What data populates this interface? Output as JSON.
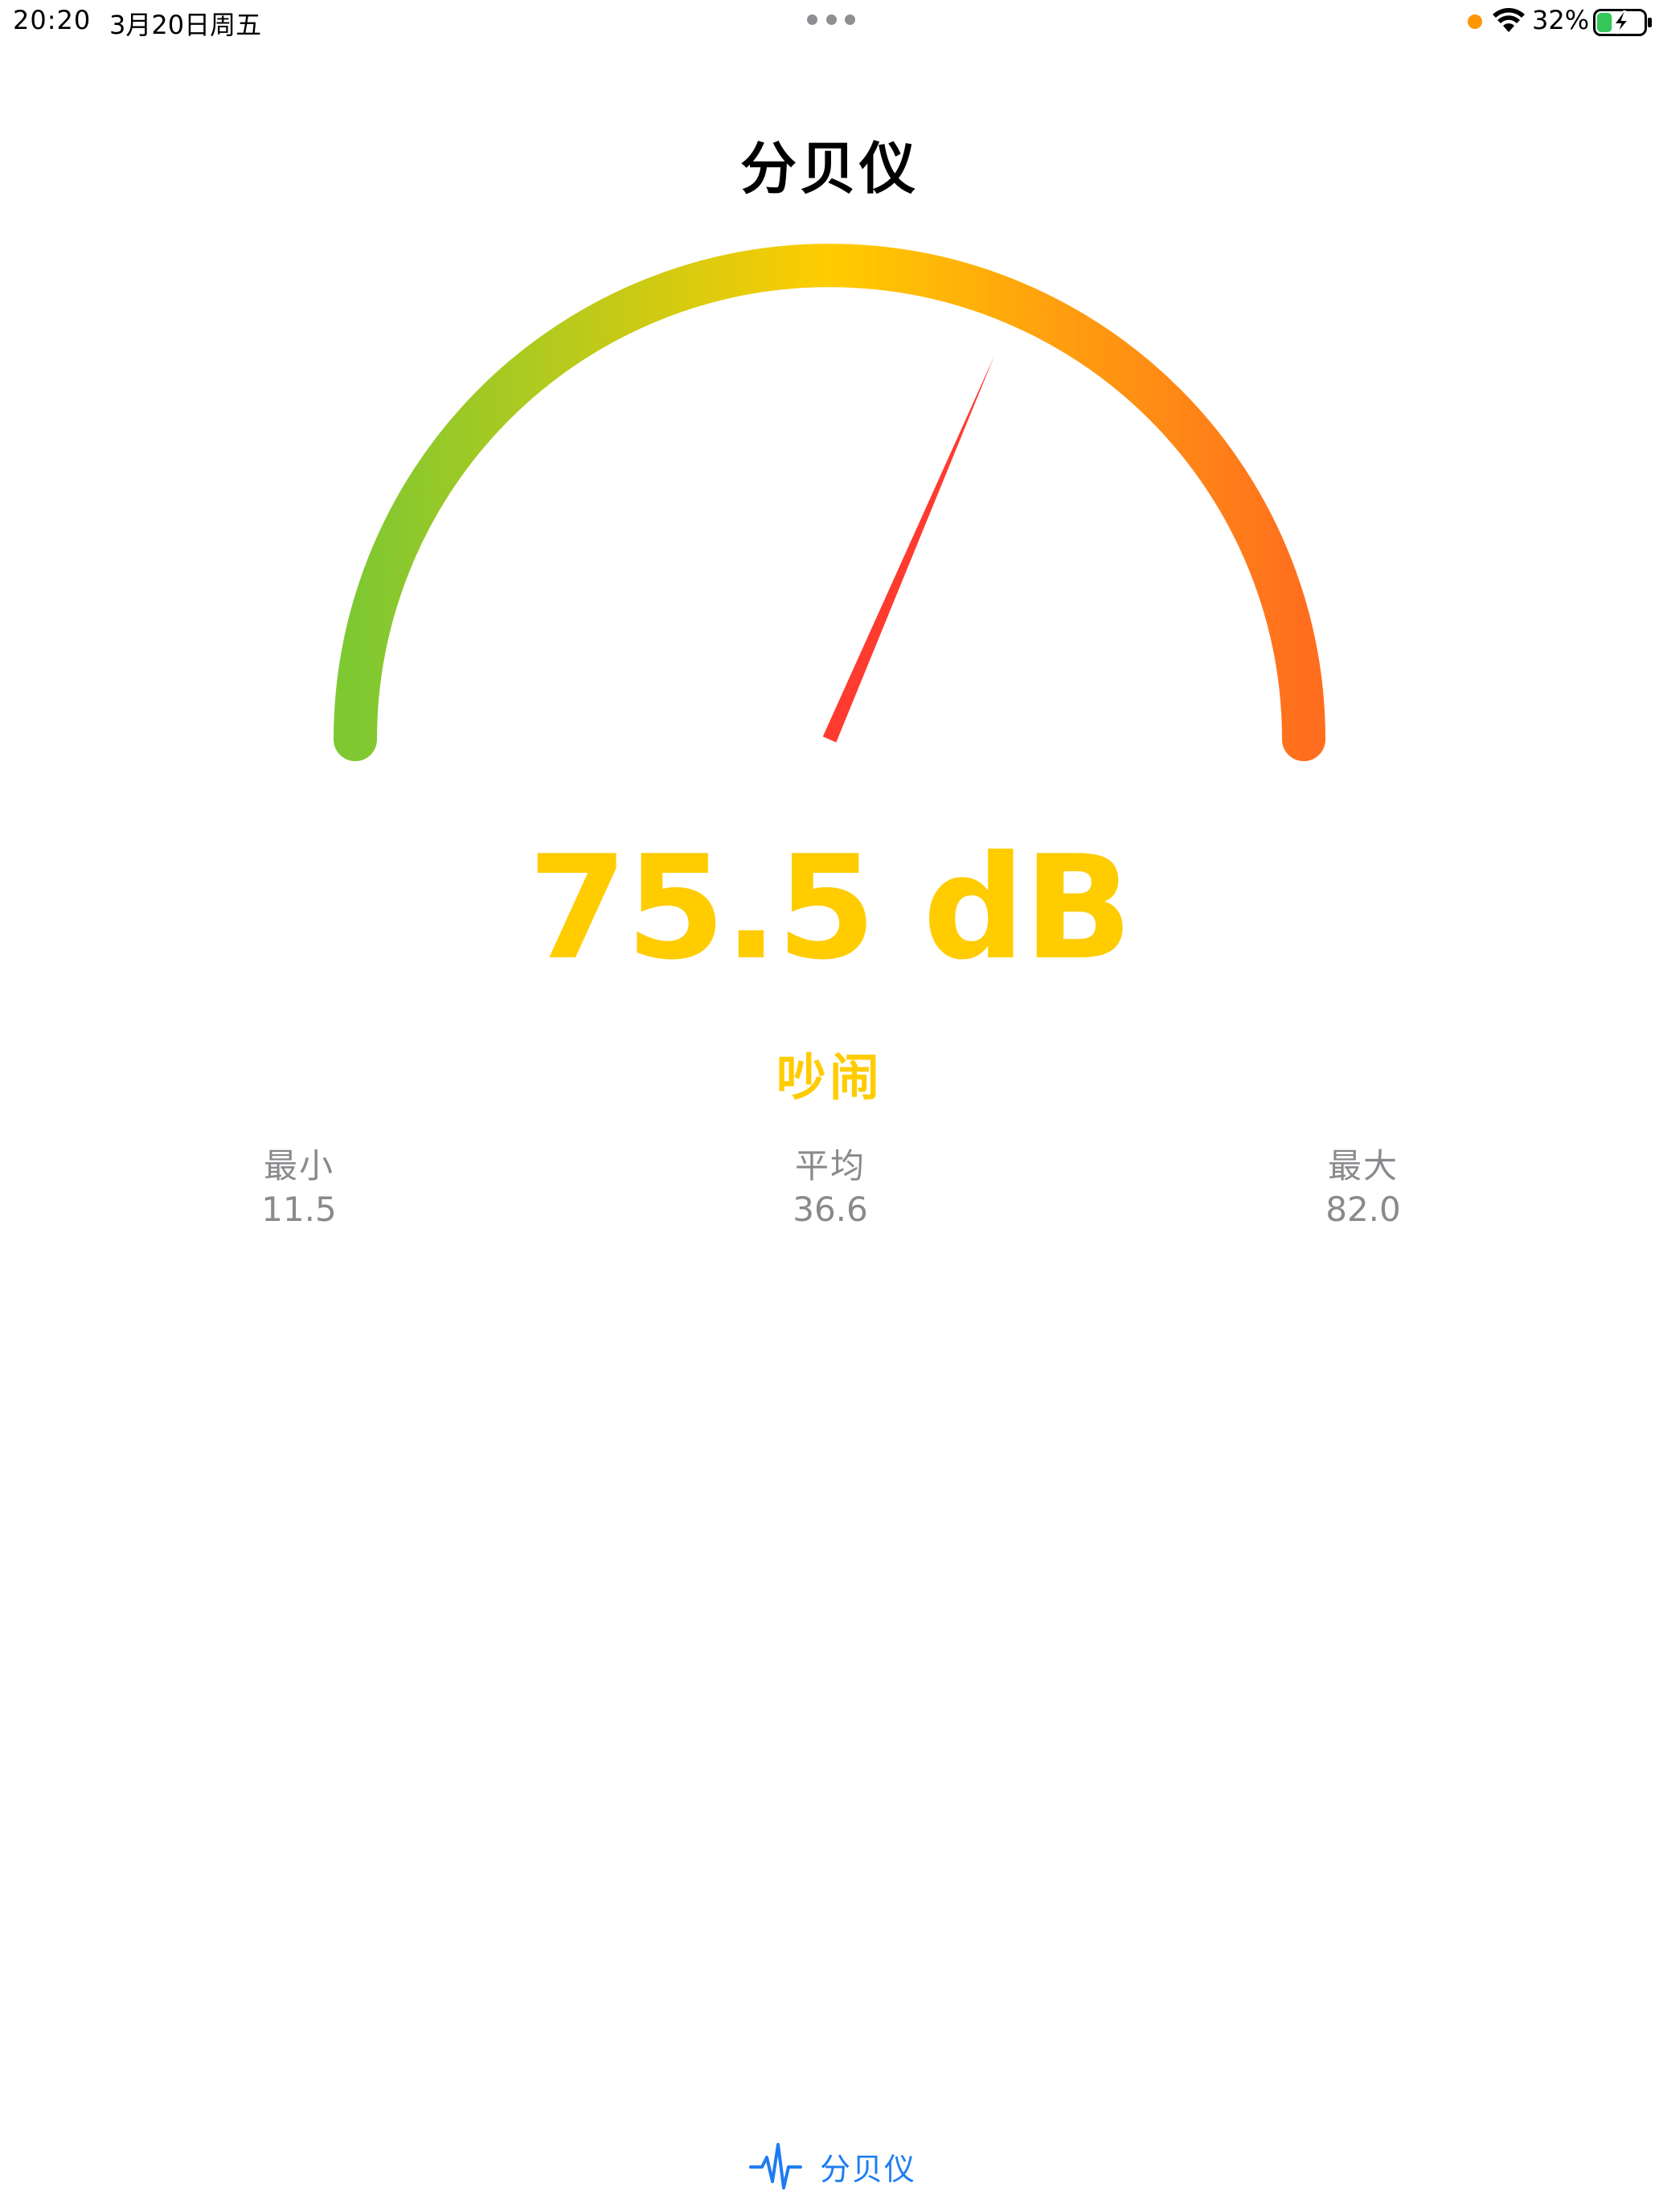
{
  "status_bar": {
    "time": "20:20",
    "date": "3月20日周五",
    "battery_percent": "32%",
    "privacy_dot_color": "#ff9500",
    "battery_fill_color": "#34c759",
    "battery_level": 0.32,
    "charging": true
  },
  "header": {
    "title": "分贝仪"
  },
  "gauge": {
    "current_db": 75.5,
    "colors": [
      "#7ec832",
      "#ffcc00",
      "#ff6e1e"
    ],
    "needle_color": "#ff3b30"
  },
  "reading": {
    "value_text": "75.5 dB",
    "level_label": "吵闹",
    "color": "#ffcc00"
  },
  "stats": {
    "min_label": "最小",
    "min_value": "11.5",
    "avg_label": "平均",
    "avg_value": "36.6",
    "max_label": "最大",
    "max_value": "82.0"
  },
  "tab_bar": {
    "items": [
      {
        "label": "分贝仪",
        "icon": "waveform-icon",
        "selected": true
      }
    ],
    "active_color": "#1e7cf2"
  }
}
